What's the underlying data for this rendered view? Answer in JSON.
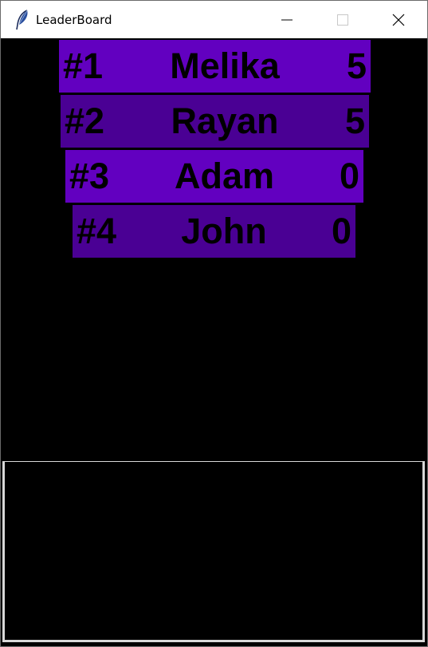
{
  "window": {
    "title": "LeaderBoard",
    "icon": "feather-icon"
  },
  "colors": {
    "background": "#000000",
    "row_light": "#6200c0",
    "row_dark": "#4a0094",
    "text": "#000000"
  },
  "leaderboard": {
    "entries": [
      {
        "rank": "#1",
        "name": "Melika",
        "score": "5"
      },
      {
        "rank": "#2",
        "name": "Rayan",
        "score": "5"
      },
      {
        "rank": "#3",
        "name": "Adam",
        "score": "0"
      },
      {
        "rank": "#4",
        "name": "John",
        "score": "0"
      }
    ]
  }
}
